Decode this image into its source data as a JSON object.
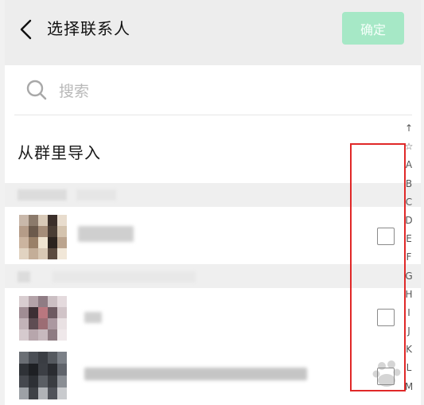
{
  "header": {
    "title": "选择联系人",
    "confirm_label": "确定",
    "confirm_color": "#a6e8c6"
  },
  "search": {
    "placeholder": "搜索"
  },
  "import": {
    "label": "从群里导入"
  },
  "index_letters": [
    "↑",
    "☆",
    "A",
    "B",
    "C",
    "D",
    "E",
    "F",
    "G",
    "H",
    "I",
    "J",
    "K",
    "L",
    "M"
  ],
  "annotation_color": "#e02828"
}
